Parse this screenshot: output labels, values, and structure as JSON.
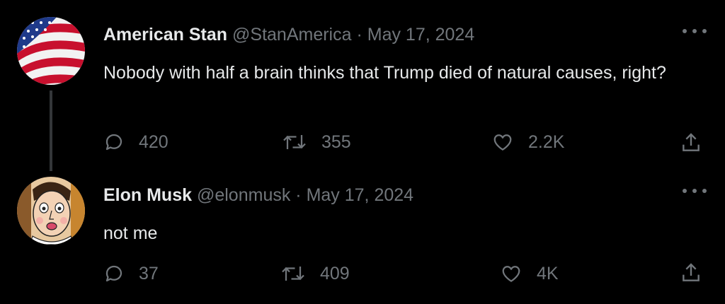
{
  "tweets": [
    {
      "name": "American Stan",
      "handle": "@StanAmerica",
      "separator": "·",
      "date": "May 17, 2024",
      "text": "Nobody with half a brain thinks that Trump died of natural causes, right?",
      "replies": "420",
      "retweets": "355",
      "likes": "2.2K"
    },
    {
      "name": "Elon Musk",
      "handle": "@elonmusk",
      "separator": "·",
      "date": "May 17, 2024",
      "text": "not me",
      "replies": "37",
      "retweets": "409",
      "likes": "4K"
    }
  ],
  "icons": {
    "reply": "reply-icon",
    "retweet": "retweet-icon",
    "like": "heart-icon",
    "share": "share-icon",
    "more": "more-icon"
  },
  "colors": {
    "background": "#000000",
    "primary_text": "#e7e9ea",
    "secondary_text": "#71767b",
    "thread_line": "#333639"
  }
}
